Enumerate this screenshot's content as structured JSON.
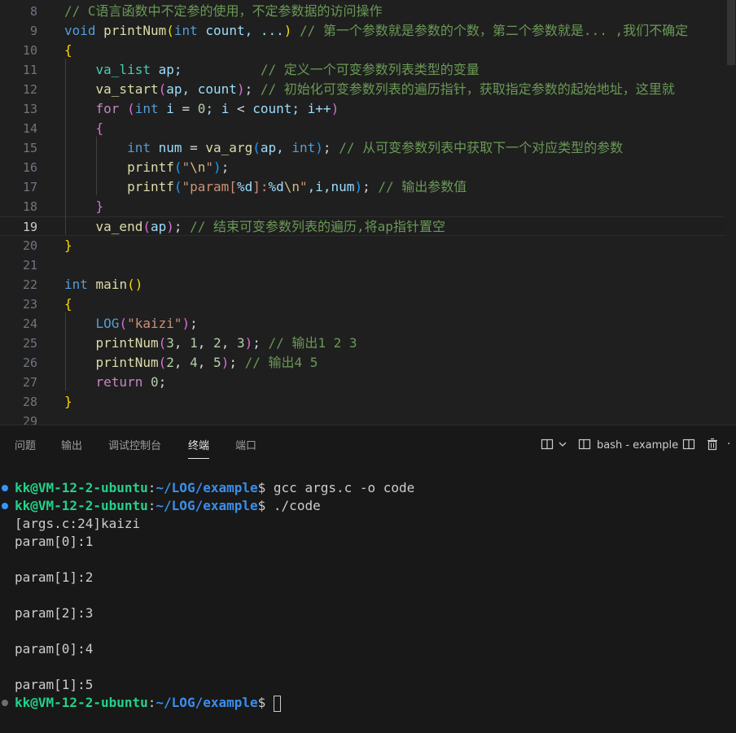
{
  "editor": {
    "lines": [
      {
        "n": "8",
        "segs": [
          [
            "// C语言函数中不定参的使用，不定参数据的访问操作",
            "cm"
          ]
        ]
      },
      {
        "n": "9",
        "segs": [
          [
            "void",
            "kw"
          ],
          [
            " ",
            "op"
          ],
          [
            "printNum",
            "fn"
          ],
          [
            "(",
            "p1"
          ],
          [
            "int",
            "kw"
          ],
          [
            " count, ...",
            "var"
          ],
          [
            ")",
            "p1"
          ],
          [
            " // 第一个参数就是参数的个数，第二个参数就是... ,我们不确定",
            "cm"
          ]
        ]
      },
      {
        "n": "10",
        "segs": [
          [
            "{",
            "p1"
          ]
        ]
      },
      {
        "n": "11",
        "segs": [
          [
            "    ",
            "op"
          ],
          [
            "va_list",
            "ty"
          ],
          [
            " ap;          ",
            "var"
          ],
          [
            "// 定义一个可变参数列表类型的变量",
            "cm"
          ]
        ]
      },
      {
        "n": "12",
        "segs": [
          [
            "    ",
            "op"
          ],
          [
            "va_start",
            "fn"
          ],
          [
            "(",
            "p2"
          ],
          [
            "ap, count",
            "var"
          ],
          [
            ")",
            "p2"
          ],
          [
            "; ",
            "op"
          ],
          [
            "// 初始化可变参数列表的遍历指针，获取指定参数的起始地址，这里就",
            "cm"
          ]
        ]
      },
      {
        "n": "13",
        "segs": [
          [
            "    ",
            "op"
          ],
          [
            "for",
            "ctl"
          ],
          [
            " ",
            "op"
          ],
          [
            "(",
            "p2"
          ],
          [
            "int",
            "kw"
          ],
          [
            " i ",
            "var"
          ],
          [
            "= ",
            "op"
          ],
          [
            "0",
            "num"
          ],
          [
            "; i ",
            "var"
          ],
          [
            "< ",
            "op"
          ],
          [
            "count; i++",
            "var"
          ],
          [
            ")",
            "p2"
          ]
        ]
      },
      {
        "n": "14",
        "segs": [
          [
            "    ",
            "op"
          ],
          [
            "{",
            "p2"
          ]
        ]
      },
      {
        "n": "15",
        "segs": [
          [
            "        ",
            "op"
          ],
          [
            "int",
            "kw"
          ],
          [
            " num ",
            "var"
          ],
          [
            "= ",
            "op"
          ],
          [
            "va_arg",
            "fn"
          ],
          [
            "(",
            "p3"
          ],
          [
            "ap, ",
            "var"
          ],
          [
            "int",
            "kw"
          ],
          [
            ")",
            "p3"
          ],
          [
            "; ",
            "op"
          ],
          [
            "// 从可变参数列表中获取下一个对应类型的参数",
            "cm"
          ]
        ]
      },
      {
        "n": "16",
        "segs": [
          [
            "        ",
            "op"
          ],
          [
            "printf",
            "fn"
          ],
          [
            "(",
            "p3"
          ],
          [
            "\"",
            "str"
          ],
          [
            "\\n",
            "esc"
          ],
          [
            "\"",
            "str"
          ],
          [
            ")",
            "p3"
          ],
          [
            ";",
            "op"
          ]
        ]
      },
      {
        "n": "17",
        "segs": [
          [
            "        ",
            "op"
          ],
          [
            "printf",
            "fn"
          ],
          [
            "(",
            "p3"
          ],
          [
            "\"param[",
            "str"
          ],
          [
            "%d",
            "var"
          ],
          [
            "]:",
            "str"
          ],
          [
            "%d",
            "var"
          ],
          [
            "\\n",
            "esc"
          ],
          [
            "\"",
            "str"
          ],
          [
            ",i,num",
            "var"
          ],
          [
            ")",
            "p3"
          ],
          [
            "; ",
            "op"
          ],
          [
            "// 输出参数值",
            "cm"
          ]
        ]
      },
      {
        "n": "18",
        "segs": [
          [
            "    ",
            "op"
          ],
          [
            "}",
            "p2"
          ]
        ]
      },
      {
        "n": "19",
        "segs": [
          [
            "    ",
            "op"
          ],
          [
            "va_end",
            "fn"
          ],
          [
            "(",
            "p2"
          ],
          [
            "ap",
            "var"
          ],
          [
            ")",
            "p2"
          ],
          [
            "; ",
            "op"
          ],
          [
            "// 结束可变参数列表的遍历,将ap指针置空",
            "cm"
          ]
        ]
      },
      {
        "n": "20",
        "segs": [
          [
            "}",
            "p1"
          ]
        ]
      },
      {
        "n": "21",
        "segs": []
      },
      {
        "n": "22",
        "segs": [
          [
            "int",
            "kw"
          ],
          [
            " ",
            "op"
          ],
          [
            "main",
            "fn"
          ],
          [
            "()",
            "p1"
          ]
        ]
      },
      {
        "n": "23",
        "segs": [
          [
            "{",
            "p1"
          ]
        ]
      },
      {
        "n": "24",
        "segs": [
          [
            "    ",
            "op"
          ],
          [
            "LOG",
            "kw"
          ],
          [
            "(",
            "p2"
          ],
          [
            "\"kaizi\"",
            "str"
          ],
          [
            ")",
            "p2"
          ],
          [
            ";",
            "op"
          ]
        ]
      },
      {
        "n": "25",
        "segs": [
          [
            "    ",
            "op"
          ],
          [
            "printNum",
            "fn"
          ],
          [
            "(",
            "p2"
          ],
          [
            "3",
            "num"
          ],
          [
            ", ",
            "op"
          ],
          [
            "1",
            "num"
          ],
          [
            ", ",
            "op"
          ],
          [
            "2",
            "num"
          ],
          [
            ", ",
            "op"
          ],
          [
            "3",
            "num"
          ],
          [
            ")",
            "p2"
          ],
          [
            "; ",
            "op"
          ],
          [
            "// 输出1 2 3",
            "cm"
          ]
        ]
      },
      {
        "n": "26",
        "segs": [
          [
            "    ",
            "op"
          ],
          [
            "printNum",
            "fn"
          ],
          [
            "(",
            "p2"
          ],
          [
            "2",
            "num"
          ],
          [
            ", ",
            "op"
          ],
          [
            "4",
            "num"
          ],
          [
            ", ",
            "op"
          ],
          [
            "5",
            "num"
          ],
          [
            ")",
            "p2"
          ],
          [
            "; ",
            "op"
          ],
          [
            "// 输出4 5",
            "cm"
          ]
        ]
      },
      {
        "n": "27",
        "segs": [
          [
            "    ",
            "op"
          ],
          [
            "return",
            "ctl"
          ],
          [
            " ",
            "op"
          ],
          [
            "0",
            "num"
          ],
          [
            ";",
            "op"
          ]
        ]
      },
      {
        "n": "28",
        "segs": [
          [
            "}",
            "p1"
          ]
        ]
      },
      {
        "n": "29",
        "segs": []
      }
    ],
    "current_line": "19"
  },
  "panel": {
    "tabs": [
      "问题",
      "输出",
      "调试控制台",
      "终端",
      "端口"
    ],
    "active_tab": "终端",
    "terminal_label": "bash - example",
    "icons": [
      "split-layout-icon",
      "chevron-down-icon",
      "terminal-icon",
      "split-icon",
      "trash-icon",
      "more-icon"
    ]
  },
  "terminal": {
    "lines": [
      {
        "kind": "prompt",
        "dot": "#3794ff",
        "user": "kk@VM-12-2-ubuntu",
        "path": "~/LOG/example",
        "cmd": " gcc args.c -o code"
      },
      {
        "kind": "prompt",
        "dot": "#3794ff",
        "user": "kk@VM-12-2-ubuntu",
        "path": "~/LOG/example",
        "cmd": " ./code"
      },
      {
        "kind": "out",
        "text": "[args.c:24]kaizi"
      },
      {
        "kind": "out",
        "text": "param[0]:1"
      },
      {
        "kind": "out",
        "text": ""
      },
      {
        "kind": "out",
        "text": "param[1]:2"
      },
      {
        "kind": "out",
        "text": ""
      },
      {
        "kind": "out",
        "text": "param[2]:3"
      },
      {
        "kind": "out",
        "text": ""
      },
      {
        "kind": "out",
        "text": "param[0]:4"
      },
      {
        "kind": "out",
        "text": ""
      },
      {
        "kind": "out",
        "text": "param[1]:5"
      },
      {
        "kind": "prompt",
        "dot": "#6e6e6e",
        "user": "kk@VM-12-2-ubuntu",
        "path": "~/LOG/example",
        "cmd": " ",
        "cursor": true
      }
    ]
  }
}
